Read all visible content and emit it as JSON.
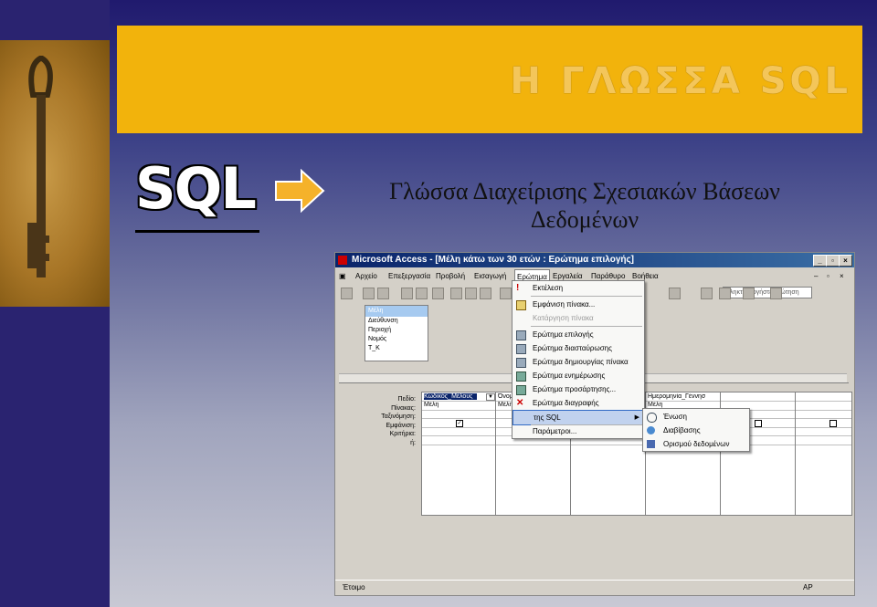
{
  "slide": {
    "title": "Η ΓΛΩΣΣΑ SQL",
    "badge": "SQL",
    "subtitle_line1": "Γλώσσα Διαχείρισης Σχεσιακών Βάσεων",
    "subtitle_line2": "Δεδομένων",
    "colors": {
      "title_band": "#f2b30c",
      "arrow": "#f5b22a"
    }
  },
  "window": {
    "title": "Microsoft Access - [Μέλη κάτω των 30 ετών : Ερώτημα επιλογής]",
    "menu": [
      "Αρχείο",
      "Επεξεργασία",
      "Προβολή",
      "Εισαγωγή",
      "Ερώτημα",
      "Εργαλεία",
      "Παράθυρο",
      "Βοήθεια"
    ],
    "ask_placeholder": "Πληκτρολογήστε ερώτηση",
    "table_box": {
      "name": "Μέλη",
      "fields": [
        "Διεύθυνση",
        "Περιοχή",
        "Νομός",
        "Τ_Κ"
      ]
    },
    "grid_row_labels": [
      "Πεδίο:",
      "Πίνακας:",
      "Ταξινόμηση:",
      "Εμφάνιση:",
      "Κριτήρια:",
      "ή:"
    ],
    "grid_columns": [
      {
        "field": "Κωδικός_Μέλους",
        "table": "Μέλη"
      },
      {
        "field": "Όνομ",
        "table": "Μέλη"
      },
      {
        "field": "",
        "table": ""
      },
      {
        "field": "Ημερομηνία_Γέννησ",
        "table": "Μέλη"
      },
      {
        "field": "",
        "table": ""
      },
      {
        "field": "",
        "table": ""
      }
    ],
    "status_left": "Έτοιμο",
    "status_right": "ΑΡ"
  },
  "query_menu": {
    "items": [
      {
        "label": "Εκτέλεση",
        "icon": "exclamation-icon",
        "enabled": true
      },
      {
        "label": "Εμφάνιση πίνακα...",
        "icon": "show-table-icon",
        "enabled": true
      },
      {
        "label": "Κατάργηση πίνακα",
        "icon": "",
        "enabled": false
      },
      {
        "label": "Ερώτημα επιλογής",
        "icon": "select-query-icon",
        "enabled": true
      },
      {
        "label": "Ερώτημα διασταύρωσης",
        "icon": "crosstab-query-icon",
        "enabled": true
      },
      {
        "label": "Ερώτημα δημιουργίας πίνακα",
        "icon": "make-table-query-icon",
        "enabled": true
      },
      {
        "label": "Ερώτημα ενημέρωσης",
        "icon": "update-query-icon",
        "enabled": true
      },
      {
        "label": "Ερώτημα προσάρτησης...",
        "icon": "append-query-icon",
        "enabled": true
      },
      {
        "label": "Ερώτημα διαγραφής",
        "icon": "delete-query-icon",
        "enabled": true
      },
      {
        "label": "της SQL",
        "icon": "",
        "enabled": true
      },
      {
        "label": "Παράμετροι...",
        "icon": "",
        "enabled": true
      }
    ]
  },
  "sql_submenu": {
    "items": [
      {
        "label": "Ένωση",
        "icon": "union-icon"
      },
      {
        "label": "Διαβίβασης",
        "icon": "pass-through-icon"
      },
      {
        "label": "Ορισμού δεδομένων",
        "icon": "data-definition-icon"
      }
    ]
  }
}
